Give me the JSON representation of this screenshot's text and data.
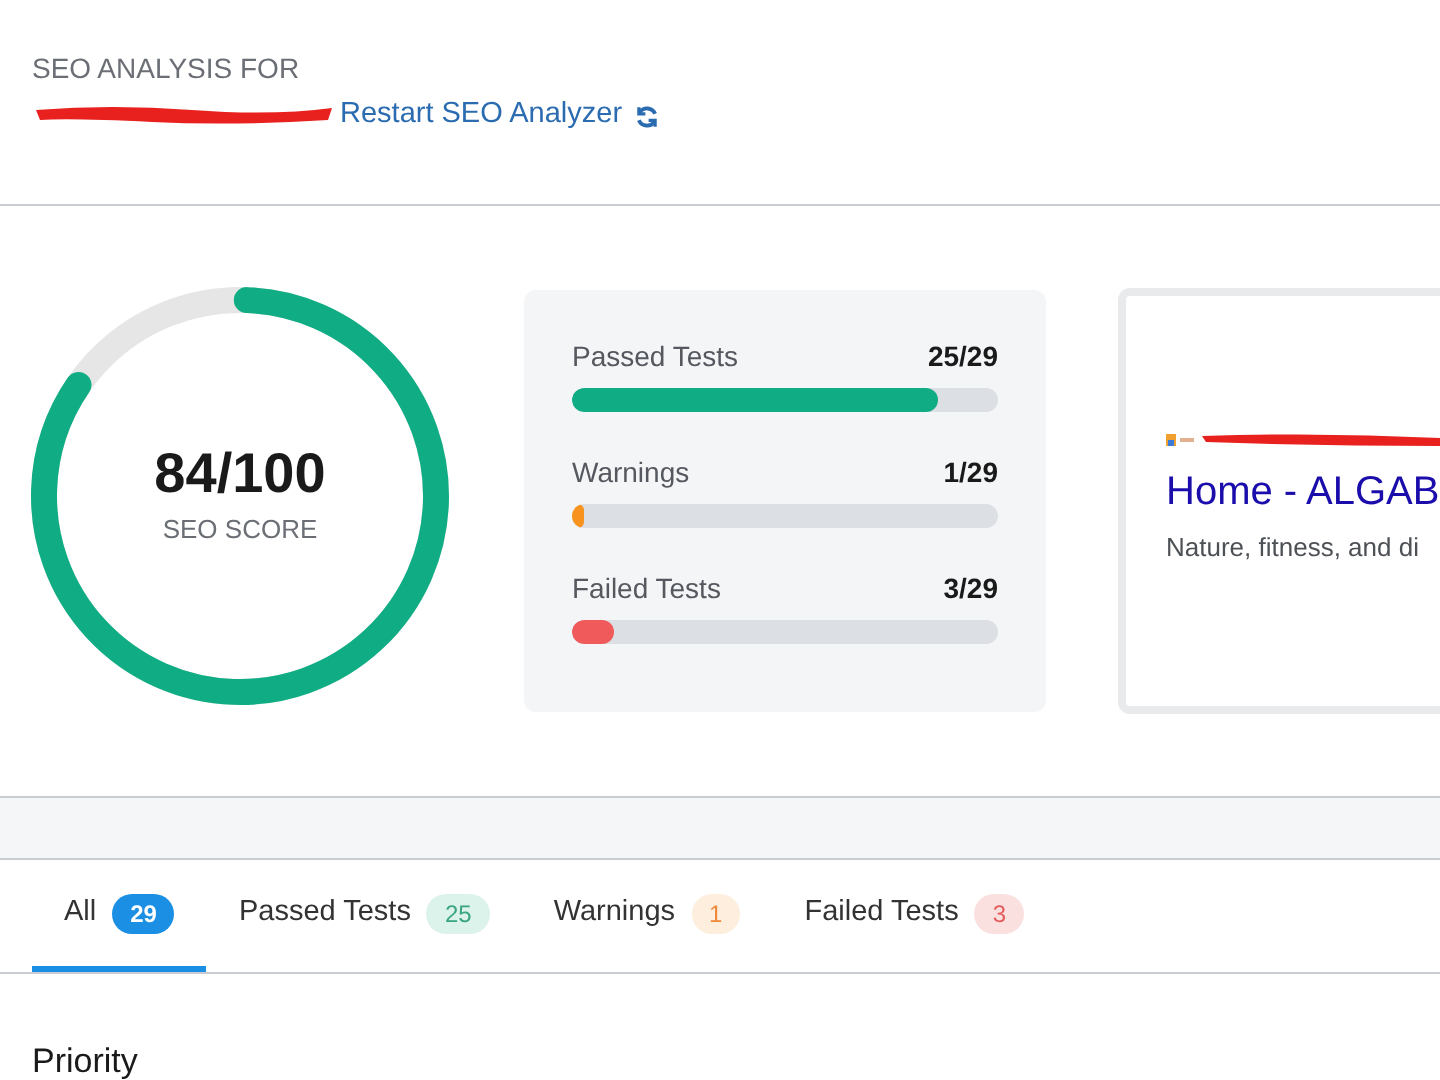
{
  "header": {
    "heading": "SEO ANALYSIS FOR",
    "restart_link": "Restart SEO Analyzer"
  },
  "score": {
    "value": "84/100",
    "label": "SEO SCORE",
    "level": 0.84
  },
  "tests": [
    {
      "label": "Passed Tests",
      "count": "25/29",
      "level": 0.86,
      "color": "#10ad85"
    },
    {
      "label": "Warnings",
      "count": "1/29",
      "level": 0.03,
      "color": "#f7931e"
    },
    {
      "label": "Failed Tests",
      "count": "3/29",
      "level": 0.1,
      "color": "#f05a5a"
    }
  ],
  "preview": {
    "title": "Home - ALGAB",
    "description": "Nature, fitness, and di"
  },
  "tabs": [
    {
      "label": "All",
      "count": "29",
      "selected": true,
      "kind": "all"
    },
    {
      "label": "Passed Tests",
      "count": "25",
      "selected": false,
      "kind": "passed"
    },
    {
      "label": "Warnings",
      "count": "1",
      "selected": false,
      "kind": "warning"
    },
    {
      "label": "Failed Tests",
      "count": "3",
      "selected": false,
      "kind": "failed"
    }
  ],
  "section_heading": "Priority"
}
